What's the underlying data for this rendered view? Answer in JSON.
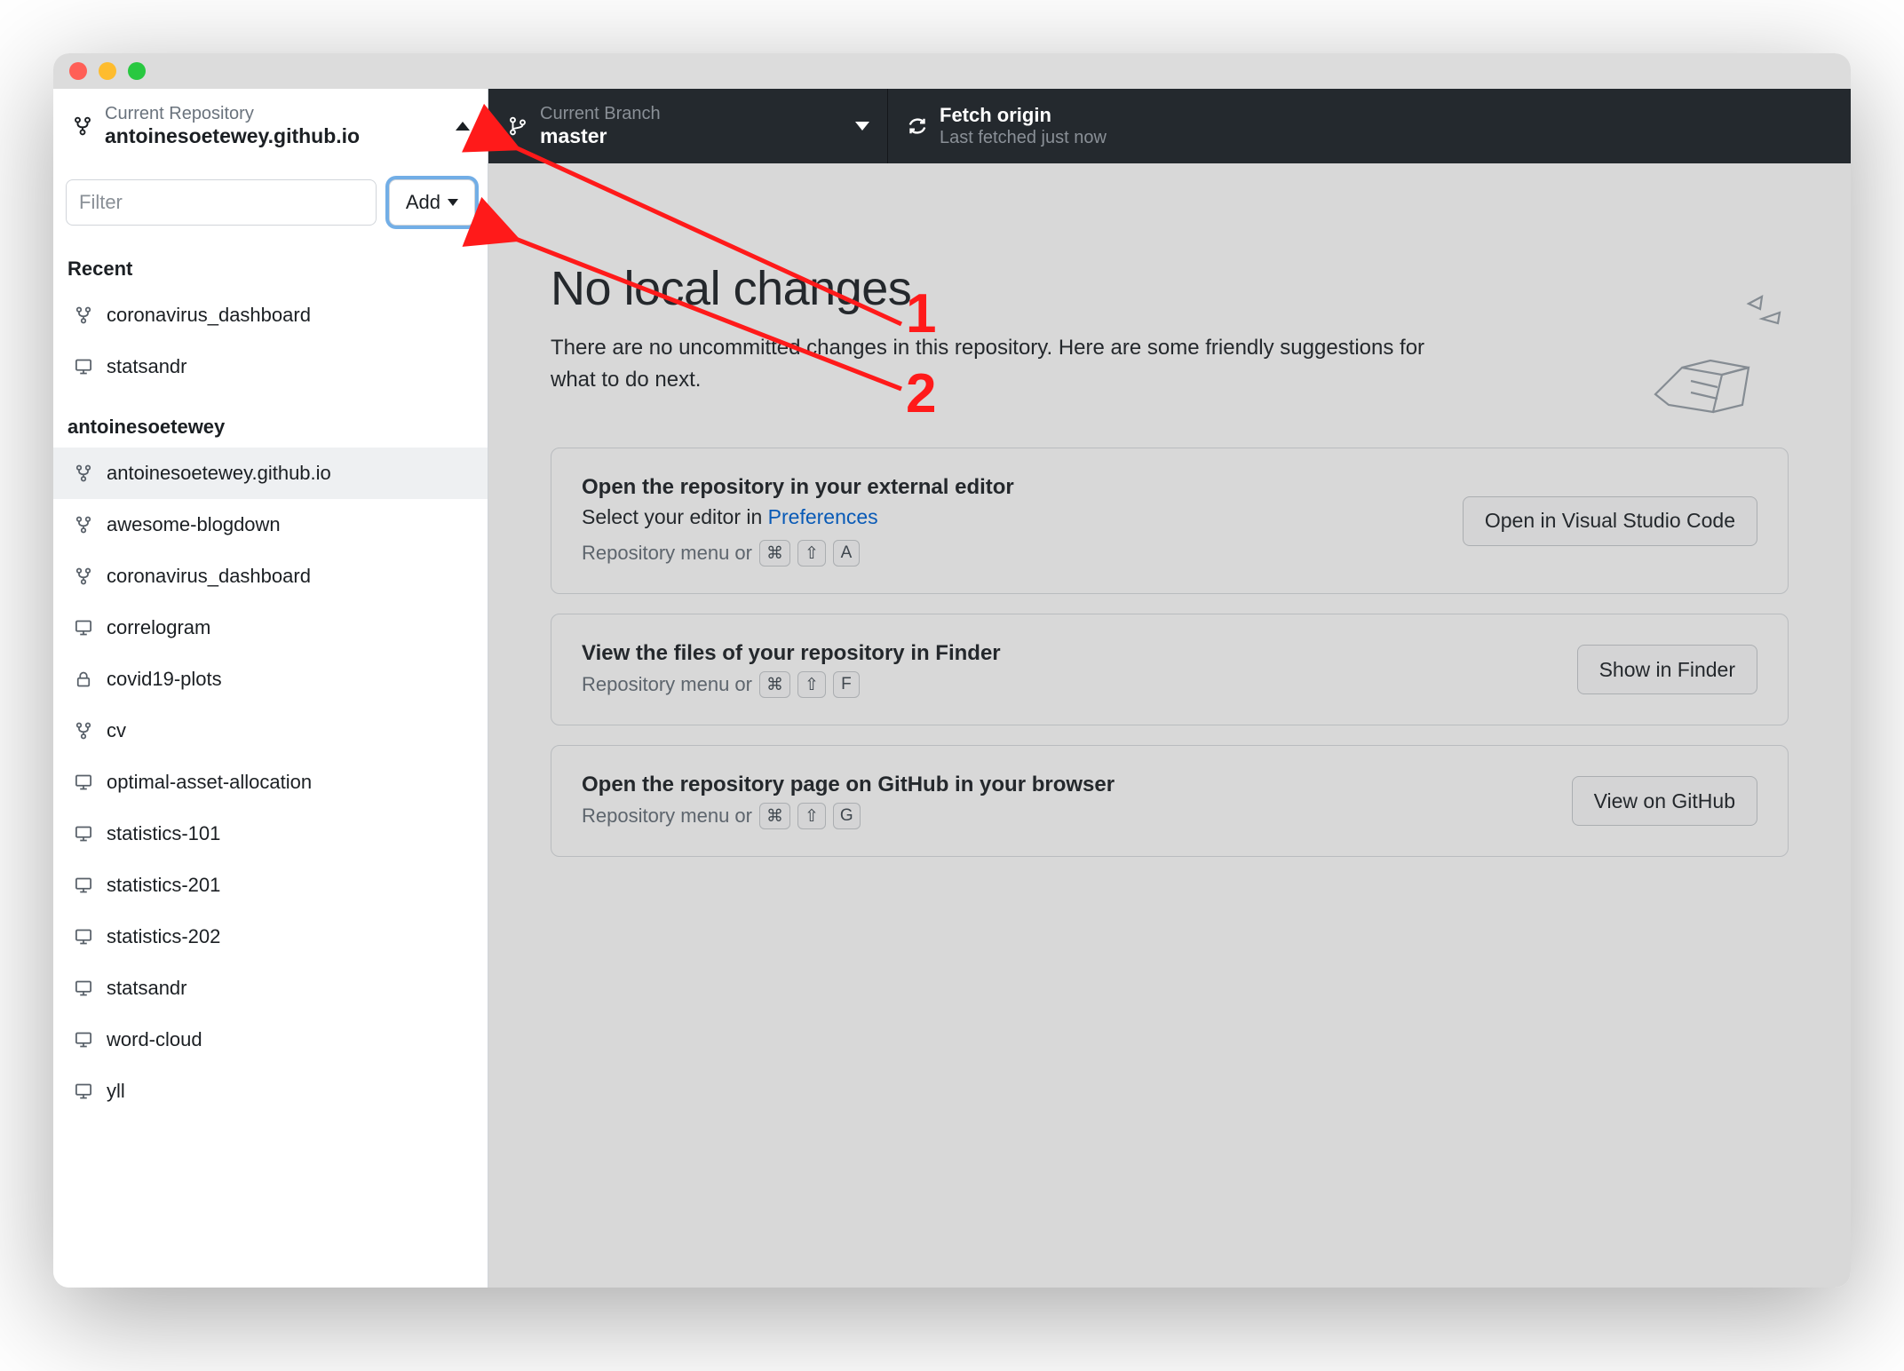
{
  "toolbar": {
    "repo": {
      "label": "Current Repository",
      "value": "antoinesoetewey.github.io"
    },
    "branch": {
      "label": "Current Branch",
      "value": "master"
    },
    "fetch": {
      "label": "Fetch origin",
      "value": "Last fetched just now"
    }
  },
  "sidebar": {
    "filter_placeholder": "Filter",
    "add_label": "Add",
    "sections": [
      {
        "header": "Recent",
        "items": [
          {
            "name": "coronavirus_dashboard",
            "icon": "git-fork"
          },
          {
            "name": "statsandr",
            "icon": "desktop"
          }
        ]
      },
      {
        "header": "antoinesoetewey",
        "items": [
          {
            "name": "antoinesoetewey.github.io",
            "icon": "git-fork",
            "selected": true
          },
          {
            "name": "awesome-blogdown",
            "icon": "git-fork"
          },
          {
            "name": "coronavirus_dashboard",
            "icon": "git-fork"
          },
          {
            "name": "correlogram",
            "icon": "desktop"
          },
          {
            "name": "covid19-plots",
            "icon": "lock"
          },
          {
            "name": "cv",
            "icon": "git-fork"
          },
          {
            "name": "optimal-asset-allocation",
            "icon": "desktop"
          },
          {
            "name": "statistics-101",
            "icon": "desktop"
          },
          {
            "name": "statistics-201",
            "icon": "desktop"
          },
          {
            "name": "statistics-202",
            "icon": "desktop"
          },
          {
            "name": "statsandr",
            "icon": "desktop"
          },
          {
            "name": "word-cloud",
            "icon": "desktop"
          },
          {
            "name": "yll",
            "icon": "desktop"
          }
        ]
      }
    ]
  },
  "main": {
    "title": "No local changes",
    "subtitle": "There are no uncommitted changes in this repository. Here are some friendly suggestions for what to do next.",
    "cards": [
      {
        "title": "Open the repository in your external editor",
        "sub_pre": "Select your editor in ",
        "sub_link": "Preferences",
        "hint_pre": "Repository menu or",
        "keys": [
          "⌘",
          "⇧",
          "A"
        ],
        "button": "Open in Visual Studio Code"
      },
      {
        "title": "View the files of your repository in Finder",
        "hint_pre": "Repository menu or",
        "keys": [
          "⌘",
          "⇧",
          "F"
        ],
        "button": "Show in Finder"
      },
      {
        "title": "Open the repository page on GitHub in your browser",
        "hint_pre": "Repository menu or",
        "keys": [
          "⌘",
          "⇧",
          "G"
        ],
        "button": "View on GitHub"
      }
    ]
  },
  "annotations": {
    "num1": "1",
    "num2": "2"
  }
}
